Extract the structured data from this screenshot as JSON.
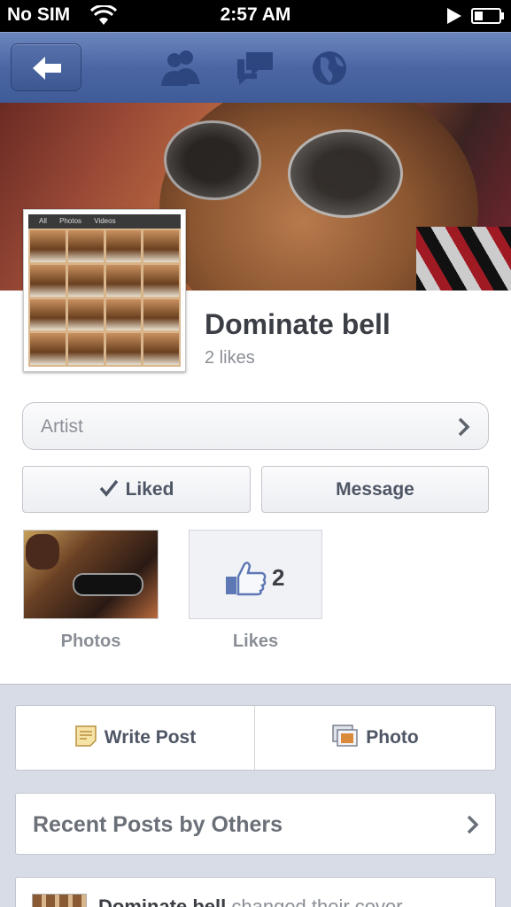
{
  "status_bar": {
    "carrier": "No SIM",
    "time": "2:57 AM"
  },
  "nav": {
    "back_icon": "back-arrow-icon",
    "icons": [
      "friends-icon",
      "messages-icon",
      "globe-icon"
    ]
  },
  "page": {
    "name": "Dominate bell",
    "likes_text": "2 likes",
    "category": "Artist",
    "avatar_tabs": [
      "All",
      "Photos",
      "Videos"
    ]
  },
  "actions": {
    "liked_label": "Liked",
    "message_label": "Message"
  },
  "tiles": {
    "photos_label": "Photos",
    "likes_label": "Likes",
    "likes_count": "2"
  },
  "composer": {
    "write_post_label": "Write Post",
    "photo_label": "Photo"
  },
  "recent_posts": {
    "label": "Recent Posts by Others"
  },
  "story": {
    "author": "Dominate bell",
    "action": "changed their cover"
  },
  "colors": {
    "nav_blue": "#4b66a3",
    "text_dark": "#3b3e44",
    "text_gray": "#8a8e96",
    "background": "#d8dce6"
  }
}
